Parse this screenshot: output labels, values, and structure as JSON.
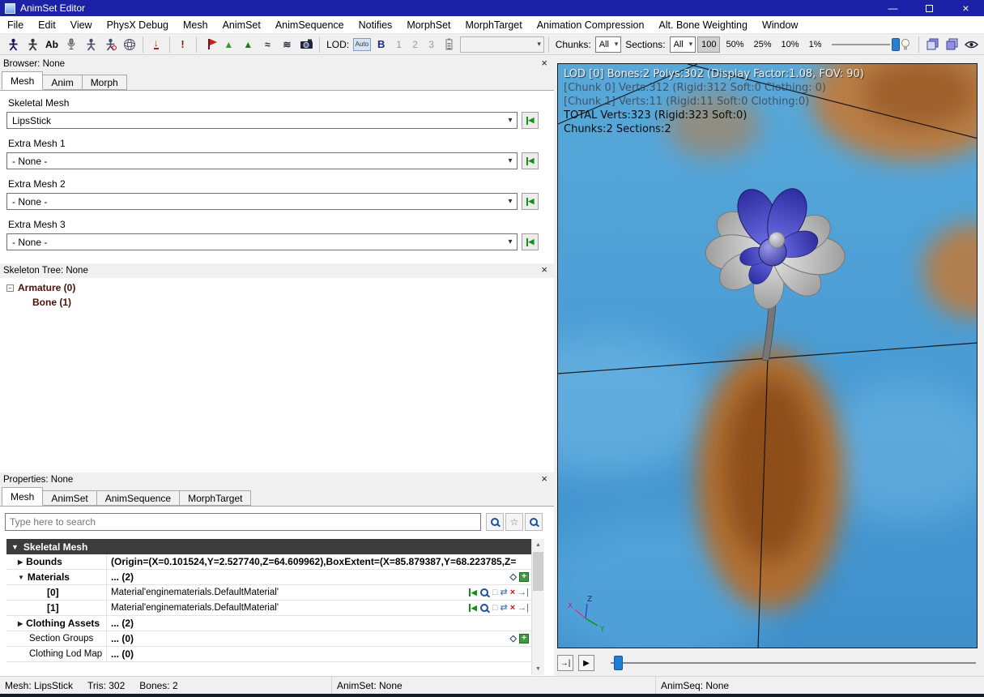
{
  "window": {
    "title": "AnimSet Editor"
  },
  "icons": {
    "close": "×",
    "minimize": "—",
    "combo_arrow": "▾",
    "use_arrow": "◀",
    "caret_right": "▶",
    "caret_down": "▼",
    "tree_minus": "−",
    "star": "☆",
    "remove_x": "×",
    "edit_swap": "⇄",
    "clear_box": "□",
    "insert_arrow": "→|",
    "diamond": "◇",
    "add_plus": "+",
    "down_arrow": "↓",
    "approx": "≈",
    "waves": "≋",
    "to_end": "→|",
    "play": "▶",
    "scroll_up": "▲",
    "scroll_down": "▼",
    "tri_up": "▲",
    "exclaim": "!"
  },
  "menubar": {
    "items": [
      "File",
      "Edit",
      "View",
      "PhysX Debug",
      "Mesh",
      "AnimSet",
      "AnimSequence",
      "Notifies",
      "MorphSet",
      "MorphTarget",
      "Animation Compression",
      "Alt. Bone Weighting",
      "Window"
    ]
  },
  "toolbar": {
    "ab_label": "Ab",
    "lod_label": "LOD:",
    "auto_label": "Auto",
    "bold_label": "B",
    "lod1": "1",
    "lod2": "2",
    "lod3": "3",
    "chunks_label": "Chunks:",
    "chunks_value": "All",
    "sections_label": "Sections:",
    "sections_value": "All",
    "zoom_100": "100",
    "zoom_50": "50%",
    "zoom_25": "25%",
    "zoom_10": "10%",
    "zoom_1": "1%"
  },
  "browser": {
    "header": "Browser: None",
    "tabs": [
      "Mesh",
      "Anim",
      "Morph"
    ],
    "skeletal_mesh_label": "Skeletal Mesh",
    "skeletal_mesh_value": "LipsStick",
    "extra1_label": "Extra Mesh 1",
    "extra1_value": "- None -",
    "extra2_label": "Extra Mesh 2",
    "extra2_value": "- None -",
    "extra3_label": "Extra Mesh 3",
    "extra3_value": "- None -"
  },
  "skeleton": {
    "header": "Skeleton Tree: None",
    "root": "Armature (0)",
    "bone": "Bone (1)"
  },
  "properties": {
    "header": "Properties: None",
    "tabs": [
      "Mesh",
      "AnimSet",
      "AnimSequence",
      "MorphTarget"
    ],
    "search_placeholder": "Type here to search",
    "group_header": "Skeletal Mesh",
    "rows": [
      {
        "label": "Bounds",
        "value": "(Origin=(X=0.101524,Y=2.527740,Z=64.609962),BoxExtent=(X=85.879387,Y=68.223785,Z="
      },
      {
        "label": "Materials",
        "value": "... (2)"
      },
      {
        "label": "[0]",
        "value": "Material'enginematerials.DefaultMaterial'"
      },
      {
        "label": "[1]",
        "value": "Material'enginematerials.DefaultMaterial'"
      },
      {
        "label": "Clothing Assets",
        "value": "... (2)"
      },
      {
        "label": "Section Groups",
        "value": "... (0)"
      },
      {
        "label": "Clothing Lod Map",
        "value": "... (0)"
      }
    ]
  },
  "viewport": {
    "stats": [
      "LOD [0] Bones:2 Polys:302 (Display Factor:1.08, FOV: 90)",
      "[Chunk 0] Verts:312 (Rigid:312 Soft:0 Clothing: 0)",
      "[Chunk 1] Verts:11 (Rigid:11 Soft:0 Clothing:0)",
      "TOTAL Verts:323 (Rigid:323 Soft:0)",
      "Chunks:2 Sections:2"
    ],
    "axis": {
      "z": "Z",
      "y": "Y",
      "x": "X"
    }
  },
  "statusbar": {
    "mesh": "Mesh: LipsStick",
    "tris": "Tris: 302",
    "bones": "Bones: 2",
    "animset": "AnimSet: None",
    "animseq": "AnimSeq: None"
  }
}
